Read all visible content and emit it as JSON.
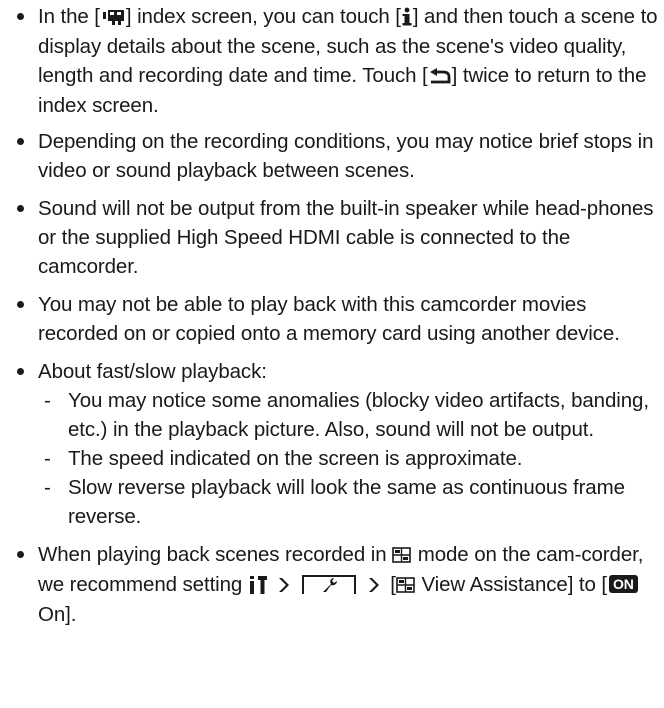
{
  "items": {
    "item1": {
      "part1": "In the [",
      "part2": "] index screen, you can touch [",
      "part3": "] and then touch a scene to display details about the scene, such as the scene's video quality, length and recording date and time. Touch [",
      "part4": "] twice to return to the index screen."
    },
    "item2": {
      "text": "Depending on the recording conditions, you may notice brief stops in video or sound playback between scenes."
    },
    "item3": {
      "text": "Sound will not be output from the built-in speaker while head-phones or the supplied High Speed HDMI cable is connected to the camcorder."
    },
    "item4": {
      "text": "You may not be able to play back with this camcorder movies recorded on or copied onto a memory card using another device."
    },
    "item5": {
      "text": "About fast/slow playback:",
      "subitems": [
        "You may notice some anomalies (blocky video artifacts, banding, etc.) in the playback picture. Also, sound will not be output.",
        "The speed indicated on the screen is approximate.",
        "Slow reverse playback will look the same as continuous frame reverse."
      ]
    },
    "item6": {
      "part1": "When playing back scenes recorded in ",
      "part2": " mode on the cam-corder, we recommend setting ",
      "part3": " [",
      "part4": " View Assistance] to [",
      "on_label": "ON",
      "part5": " On]."
    }
  },
  "icons": {
    "movie_index": "movie-index-icon",
    "info": "info-icon",
    "return": "return-icon",
    "log_mode": "log-mode-icon",
    "settings_menu": "settings-menu-icon",
    "arrow": "arrow-right-icon",
    "wrench_tab": "wrench-tab-icon"
  },
  "colors": {
    "text": "#1a1a1a"
  }
}
